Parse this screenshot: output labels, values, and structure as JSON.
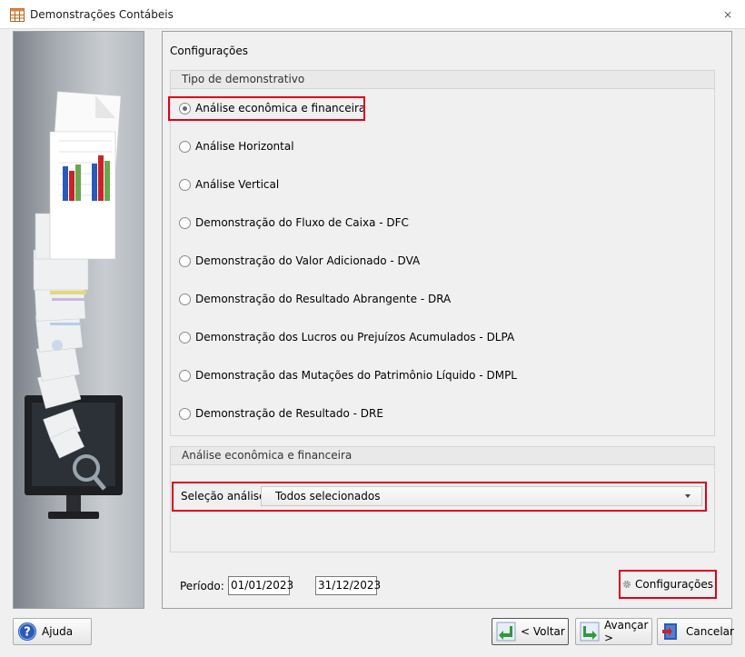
{
  "window": {
    "title": "Demonstrações Contábeis",
    "close_glyph": "⨯"
  },
  "main": {
    "section_title": "Configurações",
    "tipo_group": {
      "header": "Tipo de demonstrativo",
      "options": [
        {
          "label": "Análise econômica e financeira",
          "selected": true
        },
        {
          "label": "Análise Horizontal",
          "selected": false
        },
        {
          "label": "Análise Vertical",
          "selected": false
        },
        {
          "label": "Demonstração do Fluxo de Caixa - DFC",
          "selected": false
        },
        {
          "label": "Demonstração do Valor Adicionado - DVA",
          "selected": false
        },
        {
          "label": "Demonstração do Resultado Abrangente - DRA",
          "selected": false
        },
        {
          "label": "Demonstração dos Lucros ou Prejuízos Acumulados - DLPA",
          "selected": false
        },
        {
          "label": "Demonstração das Mutações do Patrimônio Líquido - DMPL",
          "selected": false
        },
        {
          "label": "Demonstração de Resultado - DRE",
          "selected": false
        }
      ]
    },
    "analise_group": {
      "header": "Análise econômica e financeira",
      "selecao_label": "Seleção análise:",
      "selecao_value": "Todos selecionados"
    },
    "periodo": {
      "label": "Período:",
      "start": "01/01/2023",
      "end": "31/12/2023"
    },
    "config_button": "Configurações"
  },
  "footer": {
    "help_button": "Ajuda",
    "back_button": "< Voltar",
    "next_button": "Avançar >",
    "cancel_button": "Cancelar"
  },
  "colors": {
    "highlight": "#e0001a",
    "help_icon": "#2a5ab8",
    "back_icon": "#2f9a3a"
  }
}
